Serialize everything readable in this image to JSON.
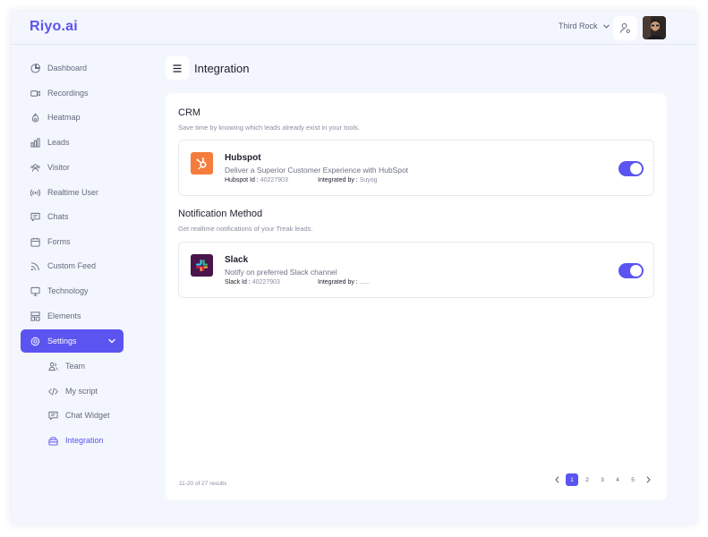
{
  "app": {
    "name": "Riyo.ai"
  },
  "header": {
    "org_name": "Third Rock"
  },
  "sidebar": {
    "items": [
      {
        "label": "Dashboard",
        "icon": "pie-chart-icon"
      },
      {
        "label": "Recordings",
        "icon": "video-icon"
      },
      {
        "label": "Heatmap",
        "icon": "flame-icon"
      },
      {
        "label": "Leads",
        "icon": "bar-chart-icon"
      },
      {
        "label": "Visitor",
        "icon": "users-icon"
      },
      {
        "label": "Realtime User",
        "icon": "broadcast-icon"
      },
      {
        "label": "Chats",
        "icon": "chat-icon"
      },
      {
        "label": "Forms",
        "icon": "calendar-icon"
      },
      {
        "label": "Custom Feed",
        "icon": "rss-icon"
      },
      {
        "label": "Technology",
        "icon": "monitor-icon"
      },
      {
        "label": "Elements",
        "icon": "layout-icon"
      },
      {
        "label": "Settings",
        "icon": "gear-icon",
        "active": true
      }
    ],
    "sub_items": [
      {
        "label": "Team",
        "icon": "team-icon"
      },
      {
        "label": "My script",
        "icon": "code-icon"
      },
      {
        "label": "Chat Widget",
        "icon": "chat-widget-icon"
      },
      {
        "label": "Integration",
        "icon": "integration-icon",
        "current": true
      }
    ]
  },
  "page": {
    "title": "Integration"
  },
  "crm": {
    "title": "CRM",
    "description": "Save time by knowing which leads already exist in your tools.",
    "integration": {
      "name": "Hubspot",
      "description": "Deliver a Superior Customer Experience with HubSpot",
      "id_label": "Hubspot Id :",
      "id_value": "40227903",
      "by_label": "Integrated by :",
      "by_value": "Suyog",
      "enabled": true
    }
  },
  "notification": {
    "title": "Notification Method",
    "description": "Get realtime notifications of your Treak leads.",
    "integration": {
      "name": "Slack",
      "description": "Notify on preferred Slack channel",
      "id_label": "Slack Id :",
      "id_value": "40227903",
      "by_label": "Integrated by :",
      "by_value": "......",
      "enabled": true
    }
  },
  "footer": {
    "results_text": "11-20 of 27 results",
    "pages": [
      "1",
      "2",
      "3",
      "4",
      "5"
    ],
    "current_page": "1"
  },
  "colors": {
    "accent": "#5b54f0",
    "hubspot": "#f57c3c",
    "slack_bg": "#4a154b"
  }
}
